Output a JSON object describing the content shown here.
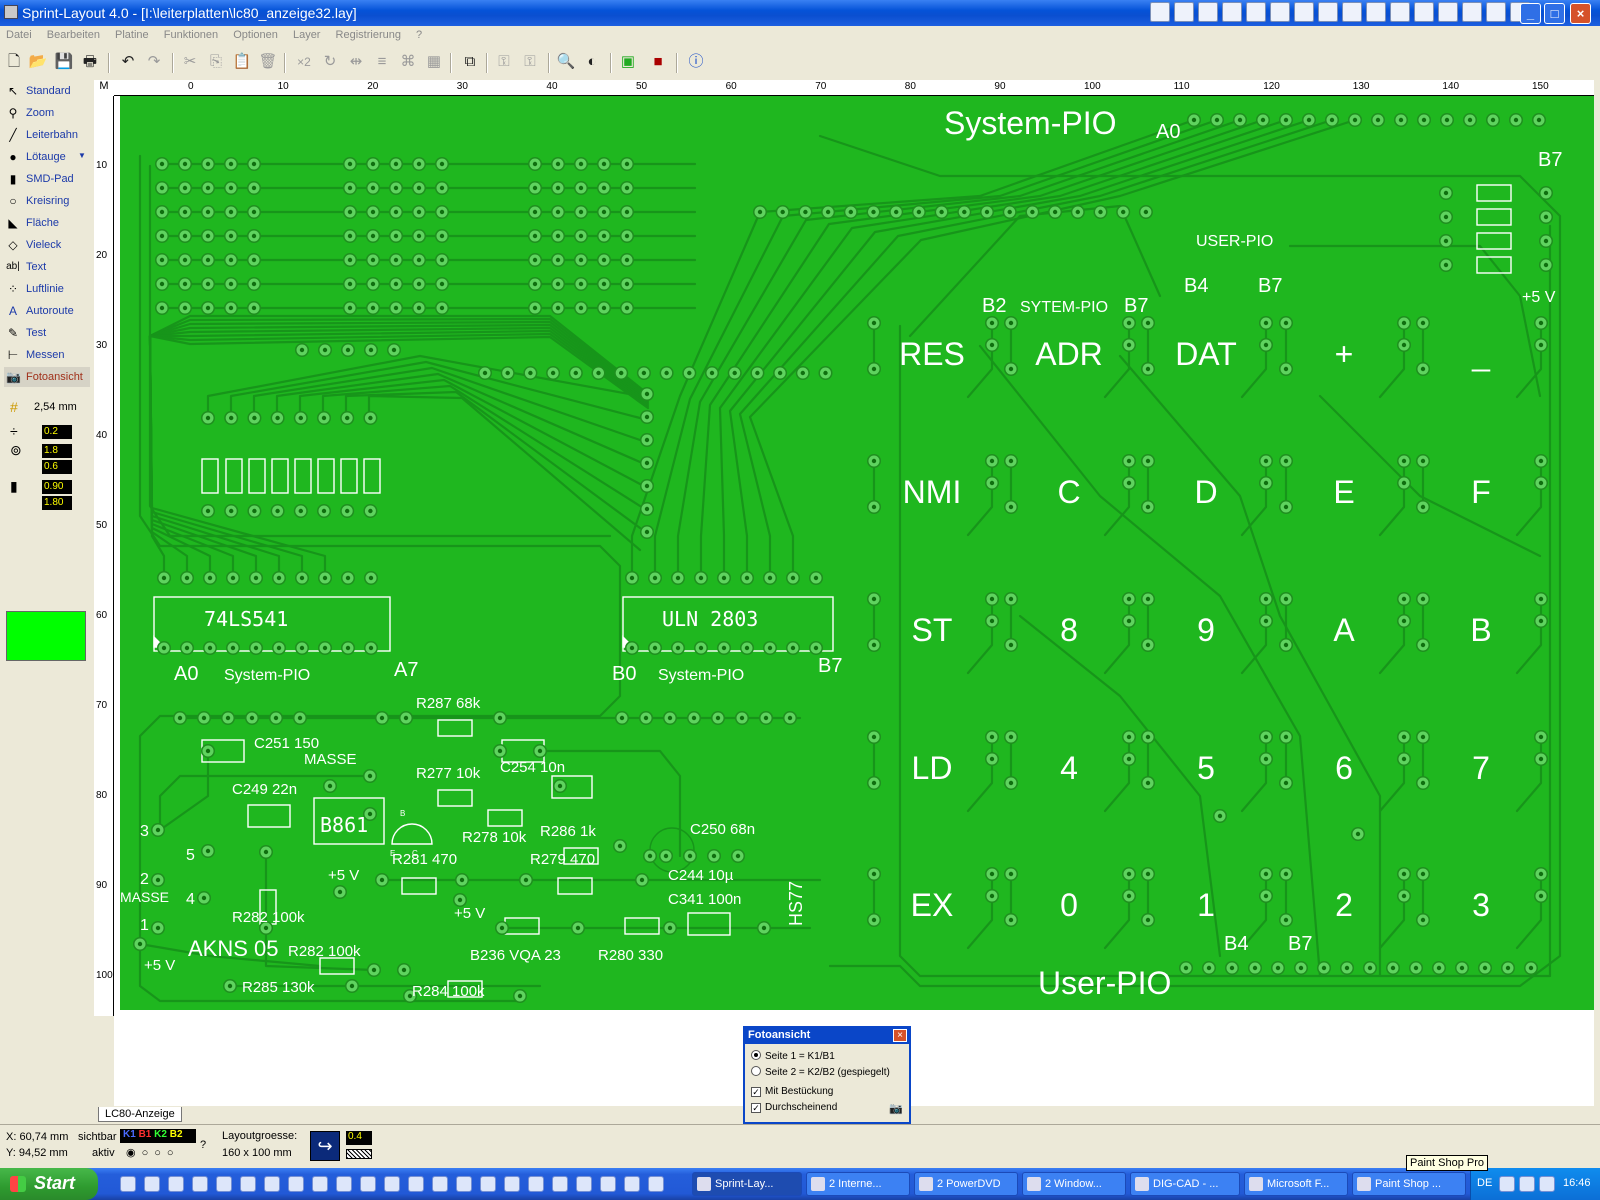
{
  "window": {
    "title": "Sprint-Layout 4.0 - [I:\\leiterplatten\\lc80_anzeige32.lay]"
  },
  "menu": [
    "Datei",
    "Bearbeiten",
    "Platine",
    "Funktionen",
    "Optionen",
    "Layer",
    "Registrierung",
    "?"
  ],
  "tools": [
    {
      "label": "Standard",
      "icon": "arrow-icon"
    },
    {
      "label": "Zoom",
      "icon": "magnifier-icon"
    },
    {
      "label": "Leiterbahn",
      "icon": "track-icon"
    },
    {
      "label": "Lötauge",
      "icon": "pad-icon"
    },
    {
      "label": "SMD-Pad",
      "icon": "smd-pad-icon"
    },
    {
      "label": "Kreisring",
      "icon": "ring-icon"
    },
    {
      "label": "Fläche",
      "icon": "area-icon"
    },
    {
      "label": "Vieleck",
      "icon": "polygon-icon"
    },
    {
      "label": "Text",
      "icon": "text-icon"
    },
    {
      "label": "Luftlinie",
      "icon": "airwire-icon"
    },
    {
      "label": "Autoroute",
      "icon": "autoroute-icon"
    },
    {
      "label": "Test",
      "icon": "test-icon"
    },
    {
      "label": "Messen",
      "icon": "measure-icon"
    },
    {
      "label": "Fotoansicht",
      "icon": "camera-icon"
    }
  ],
  "grid": {
    "label": "2,54 mm"
  },
  "params": {
    "track_width": "0.2",
    "pad_outer": "1.8",
    "pad_inner": "0.6",
    "smd_w": "0.90",
    "smd_h": "1.80"
  },
  "ruler": {
    "corner": "M",
    "top": [
      "0",
      "10",
      "20",
      "30",
      "40",
      "50",
      "60",
      "70",
      "80",
      "90",
      "100",
      "110",
      "120",
      "130",
      "140",
      "150"
    ],
    "left": [
      "10",
      "20",
      "30",
      "40",
      "50",
      "60",
      "70",
      "80",
      "90",
      "100"
    ]
  },
  "pcb": {
    "chips": [
      {
        "label": "74LS541"
      },
      {
        "label": "ULN 2803"
      }
    ],
    "keys": [
      [
        "RES",
        "ADR",
        "DAT",
        "+",
        "_"
      ],
      [
        "NMI",
        "C",
        "D",
        "E",
        "F"
      ],
      [
        "ST",
        "8",
        "9",
        "A",
        "B"
      ],
      [
        "LD",
        "4",
        "5",
        "6",
        "7"
      ],
      [
        "EX",
        "0",
        "1",
        "2",
        "3"
      ]
    ],
    "labels": {
      "system_pio_top": "System-PIO",
      "a0_top": "A0",
      "b7_top": "B7",
      "user_pio_small": "USER-PIO",
      "b4_a": "B4",
      "b7_a": "B7",
      "plus5v_right": "+5 V",
      "b2": "B2",
      "sytem_pio": "SYTEM-PIO",
      "b7_b": "B7",
      "a0_left": "A0",
      "system_pio_left": "System-PIO",
      "a7": "A7",
      "b0": "B0",
      "system_pio_mid": "System-PIO",
      "b7_mid": "B7",
      "r287": "R287 68k",
      "c251": "C251 150",
      "masse_mid": "MASSE",
      "r277": "R277 10k",
      "c254": "C254 10n",
      "c249": "C249 22n",
      "b861": "B861",
      "r278": "R278 10k",
      "r286": "R286 1k",
      "c250": "C250 68n",
      "n3": "3",
      "n5": "5",
      "plus5v_a": "+5 V",
      "r281": "R281 470",
      "r279": "R279 470",
      "c244": "C244 10µ",
      "n2": "2",
      "masse_left": "MASSE",
      "n4": "4",
      "c341": "C341 100n",
      "hs77": "HS77",
      "r282a": "R282 100k",
      "plus5v_b": "+5 V",
      "n1": "1",
      "akns": "AKNS 05",
      "r282b": "R282 100k",
      "b236": "B236 VQA 23",
      "r280": "R280 330",
      "plus5v_c": "+5 V",
      "r285": "R285 130k",
      "r284": "R284 100k",
      "b4_b": "B4",
      "b7_c": "B7",
      "user_pio_bottom": "User-PIO",
      "e_lbl": "E",
      "c_lbl": "C",
      "b_lbl": "B"
    }
  },
  "tab": "LC80-Anzeige",
  "fotodialog": {
    "title": "Fotoansicht",
    "opt1": "Seite 1 = K1/B1",
    "opt2": "Seite 2 = K2/B2 (gespiegelt)",
    "chk1": "Mit Bestückung",
    "chk2": "Durchscheinend"
  },
  "status": {
    "x": "X: 60,74 mm",
    "y": "Y: 94,52 mm",
    "sichtbar": "sichtbar",
    "aktiv": "aktiv",
    "layers": [
      "K1",
      "B1",
      "K2",
      "B2"
    ],
    "q": "?",
    "size_label": "Layoutgroesse:",
    "size_value": "160 x 100 mm",
    "zoom_val": "0.4"
  },
  "taskbar": {
    "start": "Start",
    "tasks": [
      "Sprint-Lay...",
      "2 Interne...",
      "2 PowerDVD",
      "2 Window...",
      "DIG-CAD - ...",
      "Microsoft F...",
      "Paint Shop ..."
    ],
    "lang": "DE",
    "clock": "16:46",
    "tooltip": "Paint Shop Pro"
  },
  "colors": {
    "board": "#1fb71f",
    "copper": "#23a623",
    "swatch": "#00ff00"
  }
}
